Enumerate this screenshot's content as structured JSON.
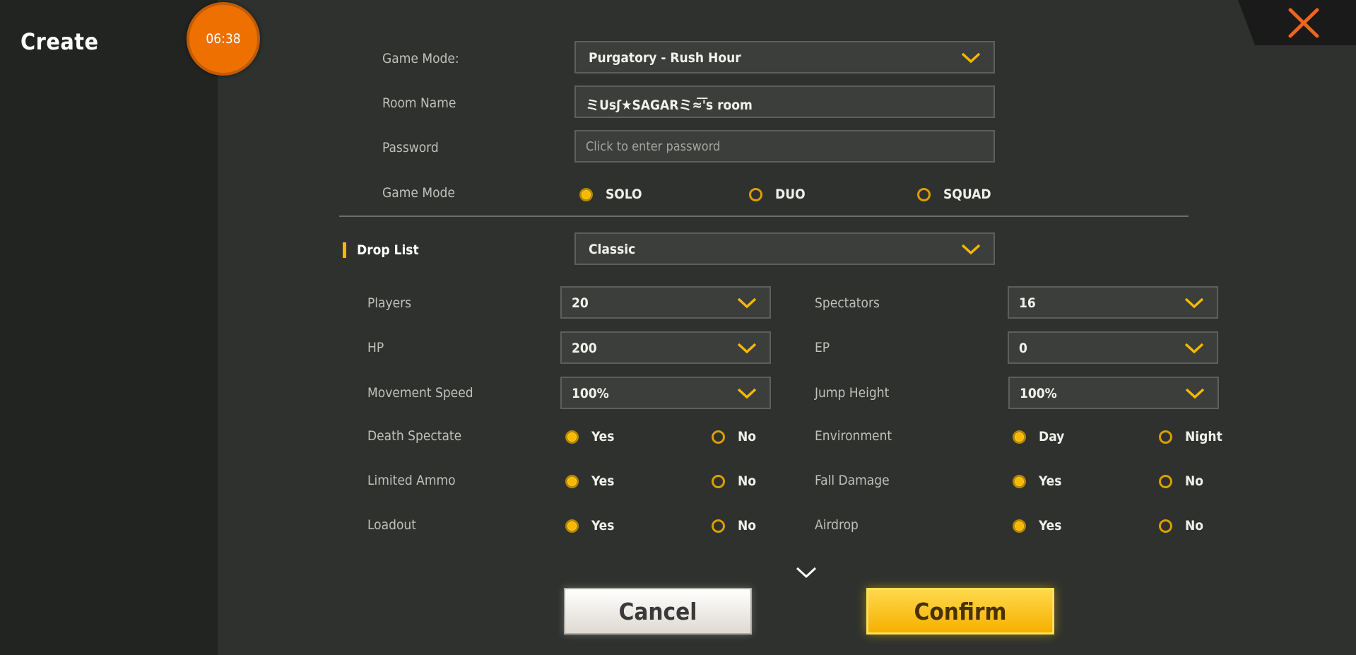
{
  "header": {
    "title": "Create",
    "timer": "06:38"
  },
  "room": {
    "game_mode_label": "Game Mode:",
    "game_mode_value": "Purgatory - Rush Hour",
    "room_name_label": "Room Name",
    "room_name_value": "ミUsʃ★SAGARミ≈͞'s room",
    "password_label": "Password",
    "password_placeholder": "Click to enter password",
    "team_mode_label": "Game Mode",
    "team_modes": [
      {
        "label": "SOLO",
        "selected": true
      },
      {
        "label": "DUO",
        "selected": false
      },
      {
        "label": "SQUAD",
        "selected": false
      }
    ]
  },
  "drop_list": {
    "label": "Drop List",
    "value": "Classic"
  },
  "settings": {
    "players": {
      "label": "Players",
      "value": "20"
    },
    "spectators": {
      "label": "Spectators",
      "value": "16"
    },
    "hp": {
      "label": "HP",
      "value": "200"
    },
    "ep": {
      "label": "EP",
      "value": "0"
    },
    "movement_speed": {
      "label": "Movement Speed",
      "value": "100%"
    },
    "jump_height": {
      "label": "Jump Height",
      "value": "100%"
    },
    "death_spectate": {
      "label": "Death Spectate",
      "options": [
        "Yes",
        "No"
      ],
      "selected": "Yes"
    },
    "environment": {
      "label": "Environment",
      "options": [
        "Day",
        "Night"
      ],
      "selected": "Day"
    },
    "limited_ammo": {
      "label": "Limited Ammo",
      "options": [
        "Yes",
        "No"
      ],
      "selected": "Yes"
    },
    "fall_damage": {
      "label": "Fall Damage",
      "options": [
        "Yes",
        "No"
      ],
      "selected": "Yes"
    },
    "loadout": {
      "label": "Loadout",
      "options": [
        "Yes",
        "No"
      ],
      "selected": "Yes"
    },
    "airdrop": {
      "label": "Airdrop",
      "options": [
        "Yes",
        "No"
      ],
      "selected": "Yes"
    }
  },
  "buttons": {
    "cancel": "Cancel",
    "confirm": "Confirm"
  },
  "colors": {
    "accent": "#f6b800",
    "timer": "#ee7100",
    "close": "#f0641e"
  },
  "icons": {
    "close": "close-x-icon",
    "dropdown": "chevron-down-icon",
    "scroll_more": "chevron-down-icon"
  }
}
